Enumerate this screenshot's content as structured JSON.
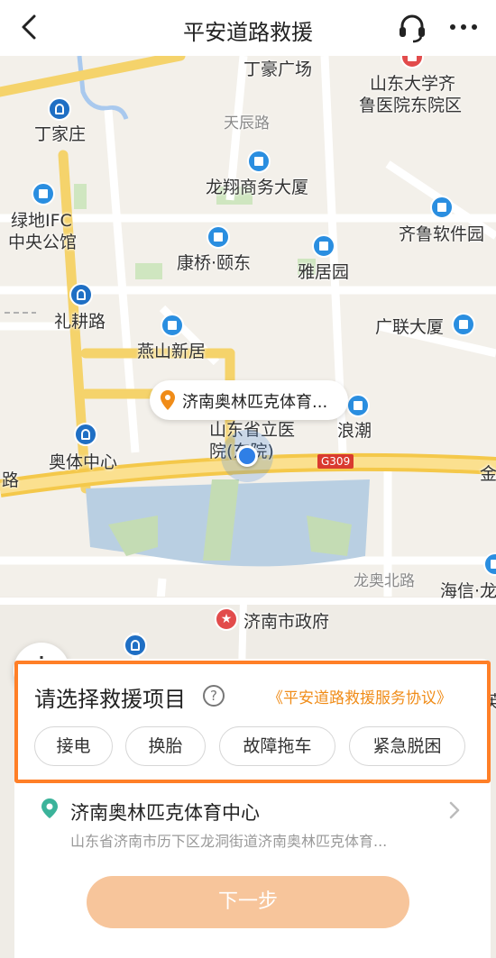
{
  "header": {
    "title": "平安道路救援",
    "back_icon": "back-arrow-icon",
    "support_icon": "headset-icon",
    "more_icon": "more-dots-icon"
  },
  "map": {
    "labels": {
      "dinghao": "丁豪广场",
      "qilu_hospital_1": "山东大学齐",
      "qilu_hospital_2": "鲁医院东院区",
      "dingjiazhuang": "丁家庄",
      "tianchen": "天辰路",
      "longxiang": "龙翔商务大厦",
      "ludi_1": "绿地IFC",
      "ludi_2": "中央公馆",
      "qilu_software": "齐鲁软件园",
      "kangqiao": "康桥·颐东",
      "yajuyuan": "雅居园",
      "ligeng": "礼耕路",
      "guanglian": "广联大厦",
      "yanshan": "燕山新居",
      "langchao": "浪潮",
      "hospital_1": "山东省立医",
      "hospital_2": "院(东院)",
      "aoti": "奥体中心",
      "road_lu": "路",
      "jin": "金",
      "longao": "龙奥北路",
      "haixin": "海信·龙",
      "gov": "济南市政府",
      "ying": "英",
      "g309": "G309"
    },
    "location_bubble": "济南奥林匹克体育...",
    "locate_icon": "locate-target-icon"
  },
  "panel": {
    "select_title": "请选择救援项目",
    "help_symbol": "?",
    "agreement": "《平安道路救援服务协议》",
    "options": [
      "接电",
      "换胎",
      "故障拖车",
      "紧急脱困"
    ],
    "address_name": "济南奥林匹克体育中心",
    "address_detail": "山东省济南市历下区龙洞街道济南奥林匹克体育...",
    "next_button": "下一步"
  },
  "colors": {
    "accent_orange": "#f08c18",
    "highlight_border": "#ff7f27",
    "next_button_bg": "#f7c59b",
    "location_blue": "#2f7fe6",
    "poi_blue": "#2a8ee0"
  }
}
